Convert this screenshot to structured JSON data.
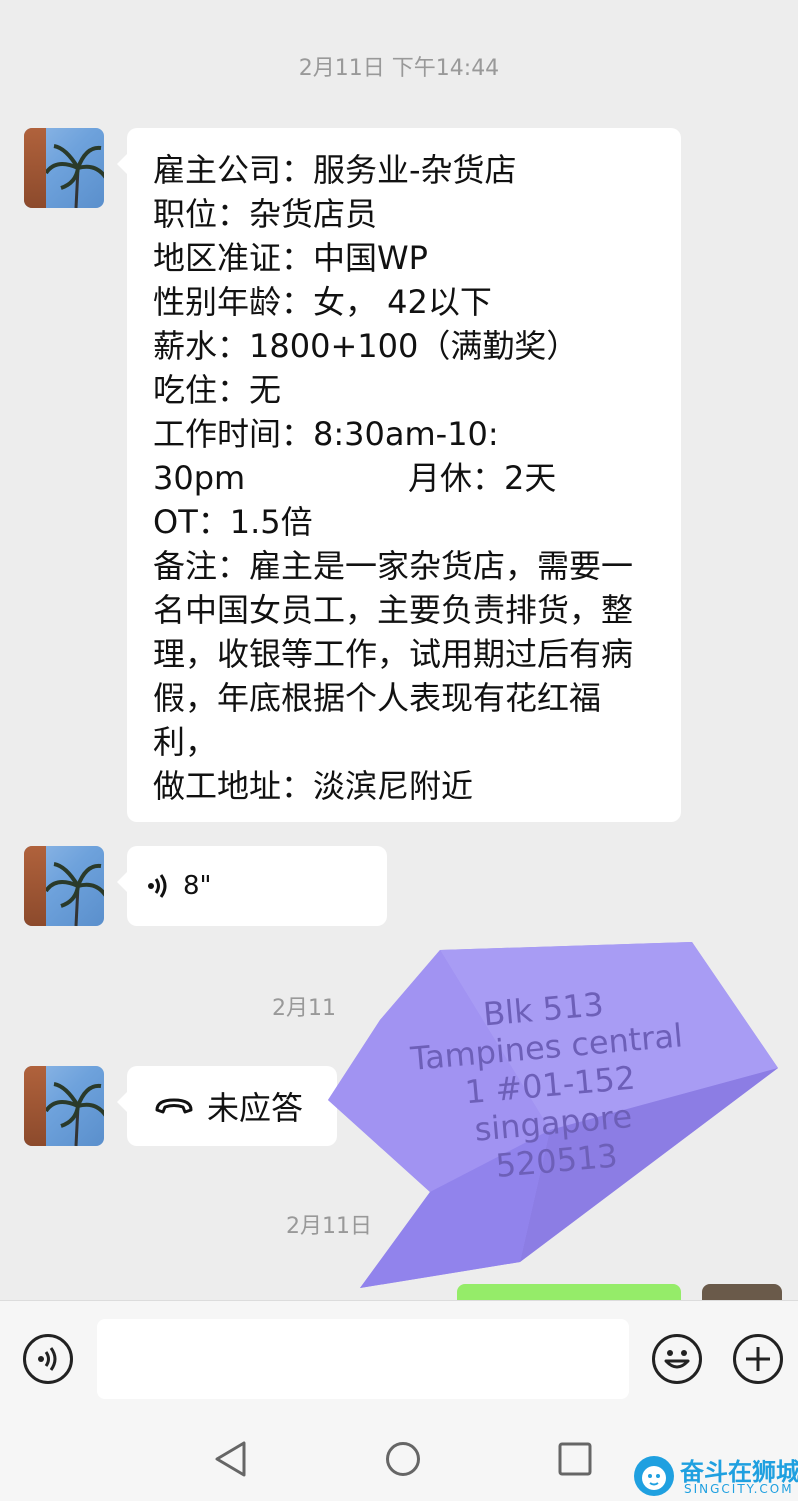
{
  "timestamps": [
    "2月11日 下午14:44",
    "2月11",
    "2月11日"
  ],
  "job_message": {
    "lines": [
      "雇主公司：服务业-杂货店",
      "职位：杂货店员",
      "地区准证：中国WP",
      "性别年龄：女， 42以下",
      "薪水：1800+100（满勤奖）",
      "吃住：无",
      "工作时间：8:30am-10:",
      "30pm                月休：2天",
      "OT：1.5倍",
      "备注：雇主是一家杂货店，需要一",
      "名中国女员工，主要负责排货，整",
      "理，收银等工作，试用期过后有病",
      "假，年底根据个人表现有花红福",
      "利，",
      "做工地址：淡滨尼附近"
    ]
  },
  "voice_message": {
    "duration": "8\""
  },
  "missed_call": {
    "label": "未应答"
  },
  "sticker": {
    "lines": [
      "Blk 513",
      "Tampines central",
      "1 #01-152",
      "singapore",
      "520513"
    ],
    "color": "#9b8cf0"
  },
  "watermark": {
    "brand": "奋斗在狮城",
    "domain": "SINGCITY.COM",
    "color": "#1fa0e0"
  },
  "icons": {
    "voice_toggle": "voice-mode-icon",
    "emoji": "emoji-icon",
    "more": "plus-icon",
    "back": "back-triangle-icon",
    "home": "home-circle-icon",
    "recent": "recent-square-icon"
  }
}
